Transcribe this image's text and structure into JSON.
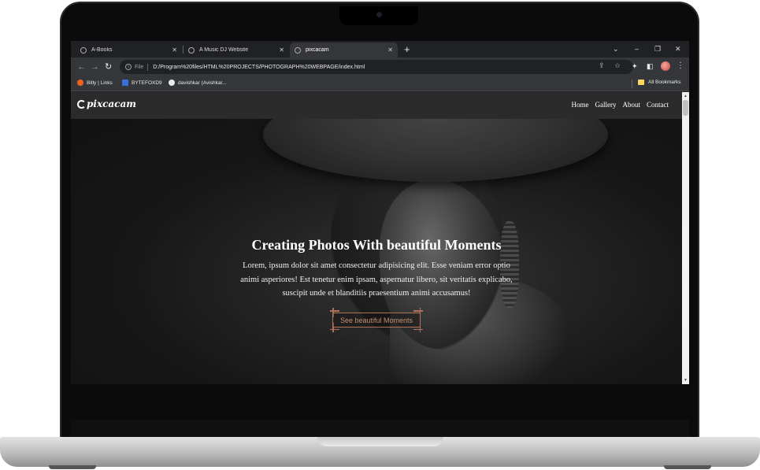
{
  "browser": {
    "tabs": [
      {
        "label": "A-Books",
        "active": false
      },
      {
        "label": "A Music DJ Website",
        "active": false
      },
      {
        "label": "pixcacam",
        "active": true
      }
    ],
    "new_tab_icon": "plus-icon",
    "address": {
      "scheme": "File",
      "url": "D:/Program%20files/HTML%20PROJECTS/PHOTOGRAPH%20WEBPAGE/index.html"
    },
    "bookmarks": [
      {
        "label": "Bitly | Links",
        "color": "#ee6123"
      },
      {
        "label": "BYTEFOXD9",
        "color": "#3a6fd8"
      },
      {
        "label": "davishkar (Avishkar...",
        "color": "#e8eaed"
      }
    ],
    "all_bookmarks": "All Bookmarks"
  },
  "site": {
    "logo": "pixcacam",
    "nav": [
      "Home",
      "Gallery",
      "About",
      "Contact"
    ],
    "hero": {
      "title": "Creating Photos With beautiful Moments",
      "text": "Lorem, ipsum dolor sit amet consectetur adipisicing elit. Esse veniam error optio animi asperiores! Est tenetur enim ipsam, aspernatur libero, sit veritatis explicabo, suscipit unde et blanditiis praesentium animi accusamus!",
      "cta": "See beautiful Moments"
    },
    "colors": {
      "accent": "#b0735a",
      "navbar": "#2b2b2b"
    }
  }
}
